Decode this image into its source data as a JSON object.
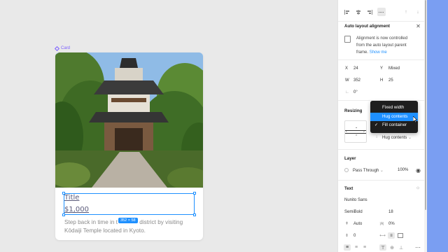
{
  "canvas": {
    "frame_label": "Card",
    "card": {
      "title": "Title",
      "price": "$1,000",
      "description": "Step back in time in the Higashiyama district by visiting Kōdaiji Temple located in Kyoto.",
      "desc_before": "Step back in time in t",
      "desc_after": " district by visiting",
      "desc_line2": "Kōdaiji Temple located in Kyoto."
    },
    "size_badge": "352 × 58"
  },
  "panel": {
    "auto_layout": {
      "title": "Auto layout alignment",
      "message": "Alignment is now controlled from the auto layout parent frame.",
      "msg_line1": "Alignment is now controlled",
      "msg_line2": "from the auto layout parent",
      "msg_line3": "frame.",
      "link": "Show me"
    },
    "position": {
      "x_label": "X",
      "x_value": "24",
      "y_label": "Y",
      "y_value": "Mixed",
      "w_label": "W",
      "w_value": "352",
      "h_label": "H",
      "h_value": "25",
      "rotation": "0°"
    },
    "resizing": {
      "title": "Resizing",
      "hug_value": "Hug contents"
    },
    "dropdown": {
      "items": [
        "Fixed width",
        "Hug contents",
        "Fill container"
      ],
      "highlighted_index": 1,
      "checked_index": 2,
      "check": "✓"
    },
    "layer": {
      "title": "Layer",
      "blend": "Pass Through",
      "opacity": "100%"
    },
    "text": {
      "title": "Text",
      "font": "Nunito Sans",
      "weight": "SemiBold",
      "size": "18",
      "line_height": "Auto",
      "letter_spacing": "0%",
      "paragraph_spacing": "0"
    },
    "colors": {
      "accent": "#1e90ff",
      "dropdown_bg": "#1e1e1e",
      "side_strip": "#7a9ef2"
    }
  }
}
